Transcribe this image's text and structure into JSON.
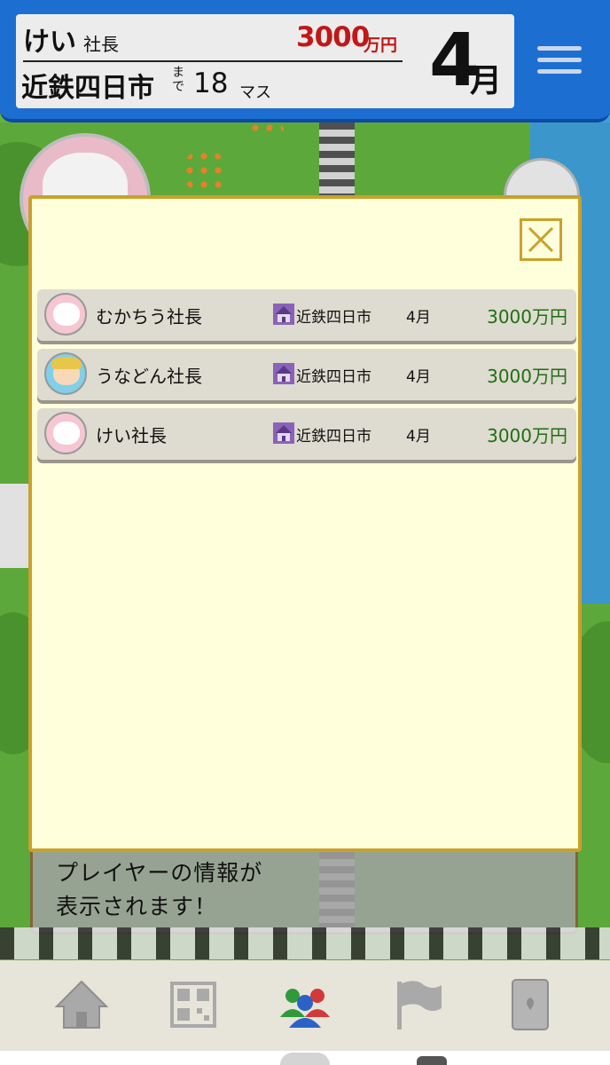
{
  "header": {
    "player_name": "けい",
    "player_title": "社長",
    "money": "3000",
    "money_unit": "万円",
    "destination": "近鉄四日市",
    "made": "まで",
    "steps": "18",
    "steps_unit": "マス",
    "month_num": "4",
    "month_unit": "月"
  },
  "modal": {
    "players": [
      {
        "name": "むかちう社長",
        "station": "近鉄四日市",
        "month": "4月",
        "money": "3000万円"
      },
      {
        "name": "うなどん社長",
        "station": "近鉄四日市",
        "month": "4月",
        "money": "3000万円"
      },
      {
        "name": "けい社長",
        "station": "近鉄四日市",
        "month": "4月",
        "money": "3000万円"
      }
    ]
  },
  "hint": {
    "line1": "プレイヤーの情報が",
    "line2": "表示されます！"
  },
  "colors": {
    "header_blue": "#1c6fd0",
    "money_red": "#c01818",
    "money_green": "#1f6f11",
    "modal_bg": "#ffffdc",
    "modal_border": "#c9a12b"
  },
  "icons": {
    "menu": "hamburger-icon",
    "close": "close-icon",
    "station": "station-icon",
    "nav": [
      "home-icon",
      "qr-code-icon",
      "players-icon",
      "flag-icon",
      "card-icon"
    ]
  }
}
